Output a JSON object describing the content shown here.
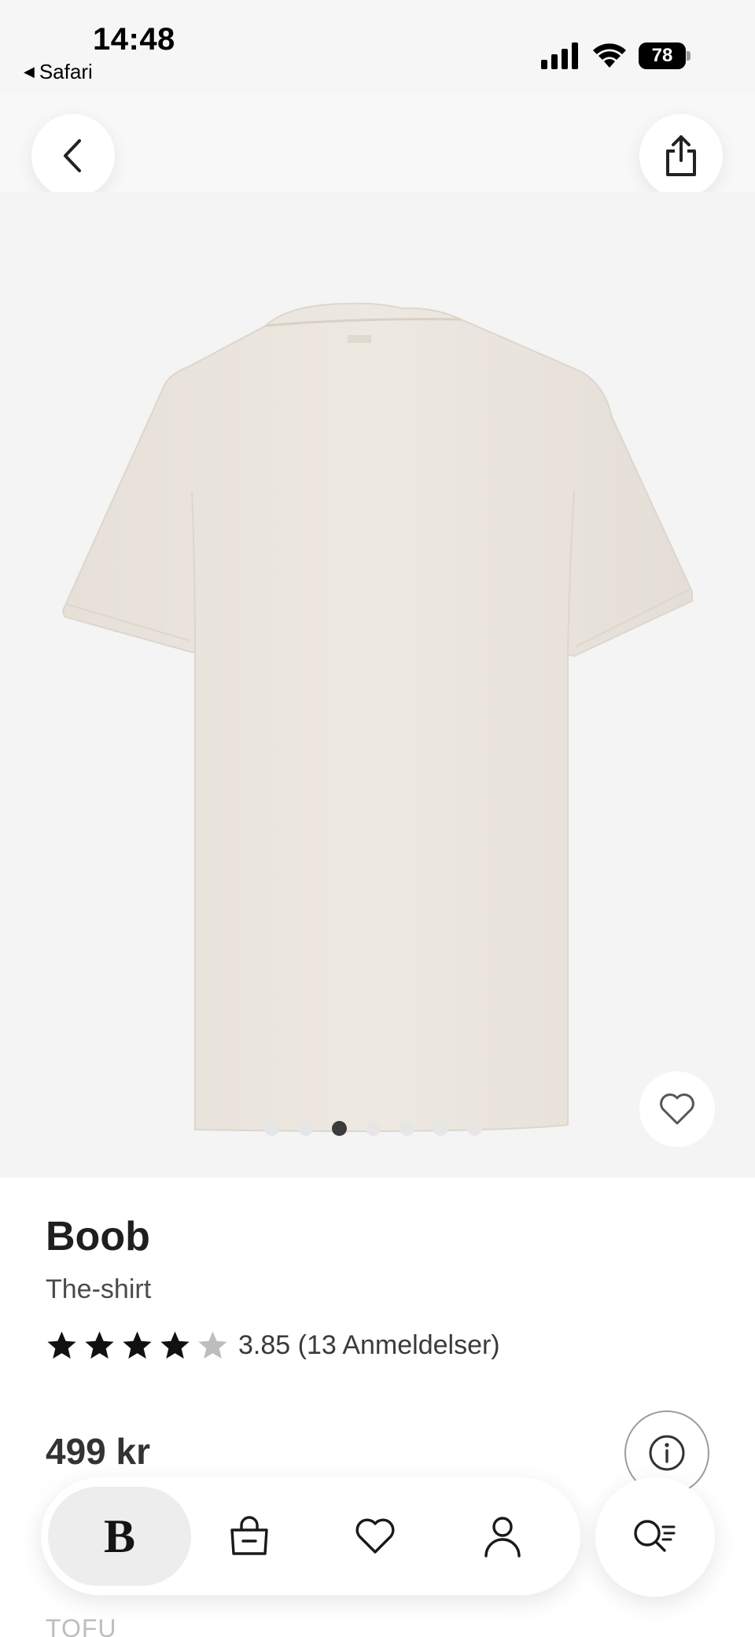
{
  "status_bar": {
    "time": "14:48",
    "back_app": "Safari",
    "battery_level": "78"
  },
  "product": {
    "brand": "Boob",
    "name": "The-shirt",
    "rating": {
      "stars_filled": 4,
      "stars_total": 5,
      "text": "3.85 (13 Anmeldelser)"
    },
    "price": "499 kr",
    "variant": "TOFU"
  },
  "gallery": {
    "total_images": 7,
    "active_index": 2
  },
  "icons": {
    "back": "chevron-left-icon",
    "share": "share-icon",
    "favorite": "heart-icon",
    "info": "info-icon",
    "bag": "shopping-bag-icon",
    "user": "user-icon",
    "search": "search-filter-icon"
  },
  "bottom_nav": {
    "home_label": "B"
  },
  "colors": {
    "background": "#ffffff",
    "image_background": "#f4f4f4",
    "shirt": "#ebe6df",
    "text": "#1f1f1f",
    "active_dot": "#3b3b3b",
    "inactive_dot": "#e6e6e6"
  }
}
